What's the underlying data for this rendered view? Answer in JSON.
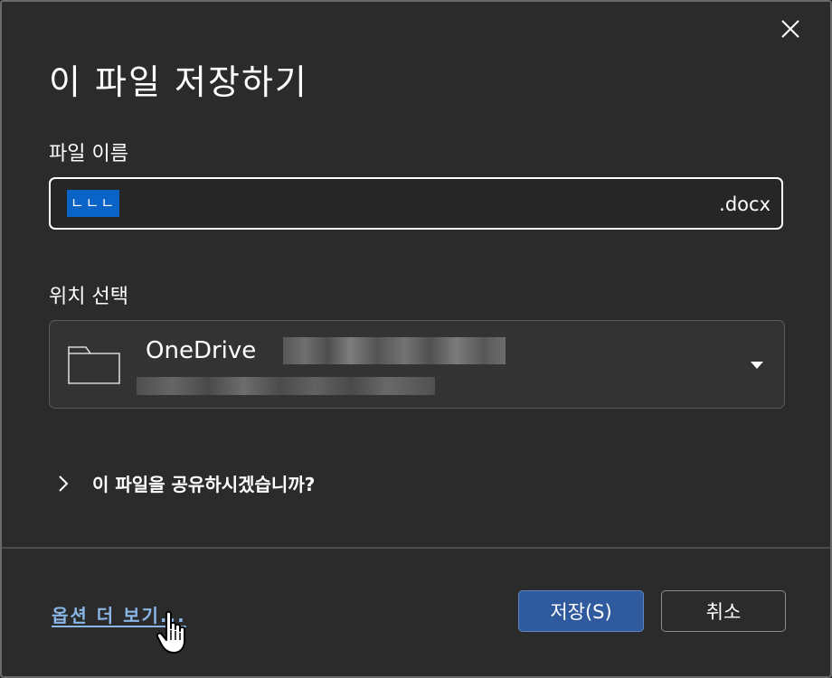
{
  "dialog": {
    "title": "이 파일 저장하기",
    "close_icon": "close-icon"
  },
  "filename": {
    "label": "파일 이름",
    "value": "ㄴㄴㄴ",
    "extension": ".docx"
  },
  "location": {
    "label": "위치 선택",
    "selected_name": "OneDrive",
    "folder_icon": "folder-icon",
    "dropdown_icon": "caret-down-icon"
  },
  "share": {
    "label": "이 파일을 공유하시겠습니까?",
    "expand_icon": "chevron-right-icon"
  },
  "footer": {
    "more_options": "옵션 더 보기...",
    "save_label": "저장(S)",
    "cancel_label": "취소"
  },
  "colors": {
    "background": "#2b2b2b",
    "accent": "#2f5a9e",
    "link": "#8ab6e8",
    "selection": "#0a64c8"
  }
}
